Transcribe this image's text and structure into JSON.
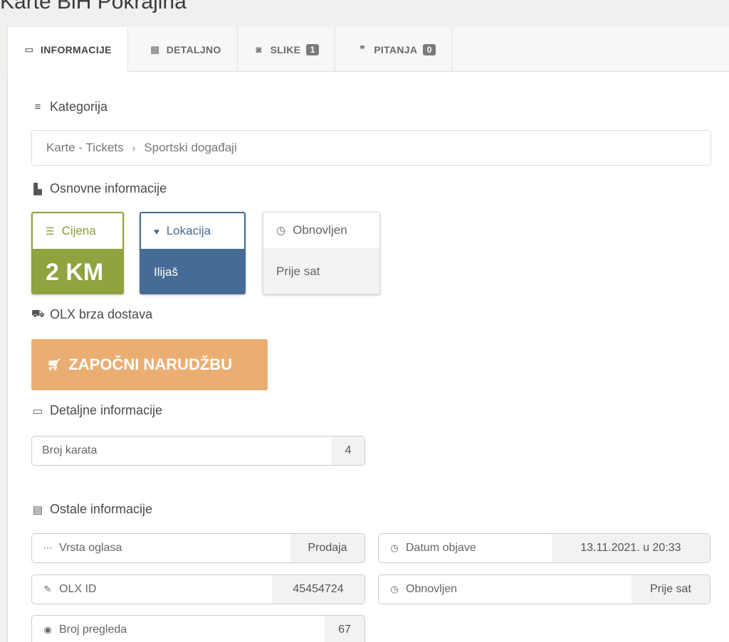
{
  "page": {
    "title": "Karte BiH Pokrajina"
  },
  "tabs": [
    {
      "label": "INFORMACIJE",
      "icon": "info-card-icon"
    },
    {
      "label": "DETALJNO",
      "icon": "document-icon"
    },
    {
      "label": "SLIKE",
      "icon": "camera-icon",
      "badge": "1"
    },
    {
      "label": "PITANJA",
      "icon": "chat-icon",
      "badge": "0"
    }
  ],
  "category": {
    "heading": "Kategorija",
    "path": [
      "Karte - Tickets",
      "Sportski događaji"
    ],
    "separator": "›"
  },
  "basic": {
    "heading": "Osnovne informacije",
    "price": {
      "label": "Cijena",
      "value": "2 KM",
      "color": "#8fa33f"
    },
    "location": {
      "label": "Lokacija",
      "value": "Ilijaš",
      "color": "#456b96"
    },
    "updated": {
      "label": "Obnovljen",
      "value": "Prije sat"
    }
  },
  "delivery": {
    "heading": "OLX brza dostava",
    "button_label": "ZAPOČNI NARUDŽBU",
    "button_color": "#ebae72"
  },
  "details": {
    "heading": "Detaljne informacije",
    "rows": [
      {
        "label": "Broj karata",
        "value": "4"
      }
    ]
  },
  "other": {
    "heading": "Ostale informacije",
    "rows": [
      {
        "label": "Vrsta oglasa",
        "value": "Prodaja",
        "icon": "dots-icon"
      },
      {
        "label": "Datum objave",
        "value": "13.11.2021. u 20:33",
        "icon": "clock-icon"
      },
      {
        "label": "OLX ID",
        "value": "45454724",
        "icon": "wrench-icon"
      },
      {
        "label": "Obnovljen",
        "value": "Prije sat",
        "icon": "clock-icon"
      },
      {
        "label": "Broj pregleda",
        "value": "67",
        "icon": "eye-icon"
      }
    ]
  }
}
